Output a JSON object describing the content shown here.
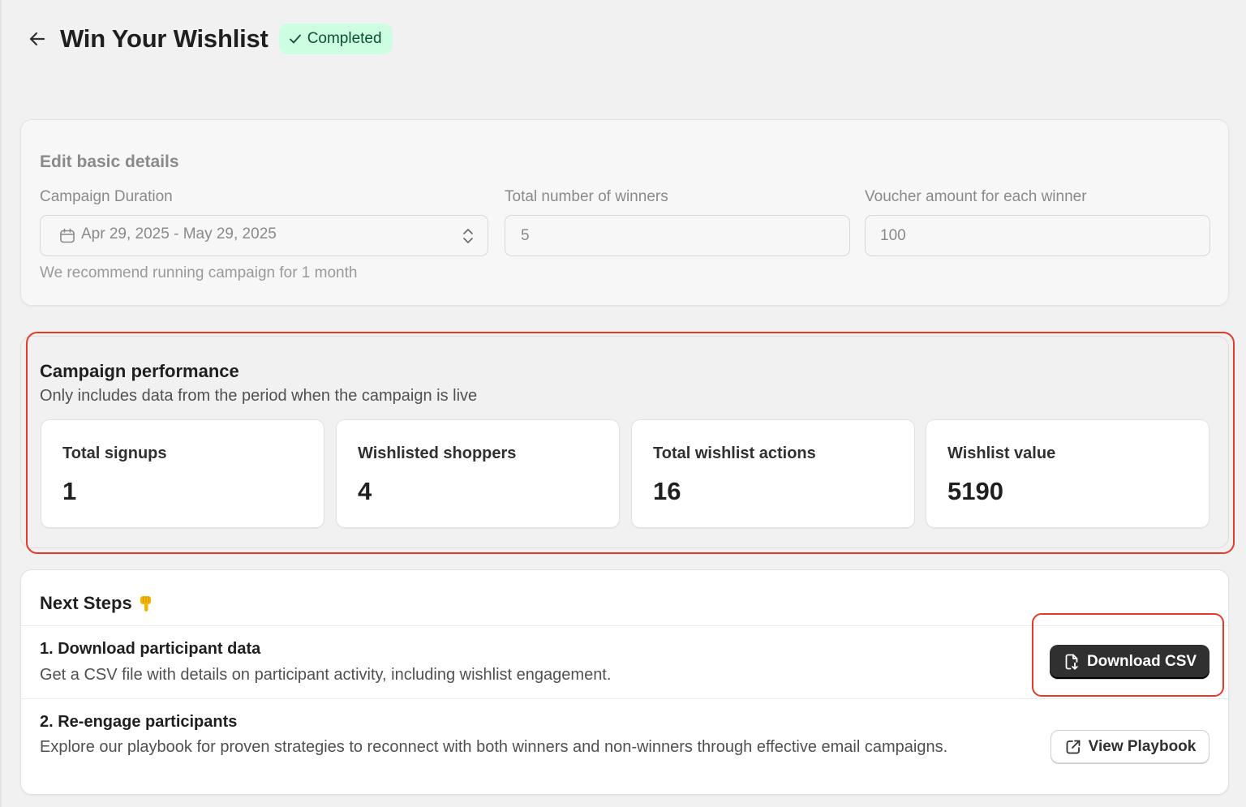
{
  "header": {
    "title": "Win Your Wishlist",
    "status_badge": "Completed"
  },
  "basic_details": {
    "title": "Edit basic details",
    "campaign_duration": {
      "label": "Campaign Duration",
      "value": "Apr 29, 2025 - May 29, 2025",
      "help": "We recommend running campaign for 1 month"
    },
    "winners": {
      "label": "Total number of winners",
      "value": "5"
    },
    "voucher": {
      "label": "Voucher amount for each winner",
      "value": "100"
    }
  },
  "performance": {
    "title": "Campaign performance",
    "subtitle": "Only includes data from the period when the campaign is live",
    "stats": [
      {
        "label": "Total signups",
        "value": "1"
      },
      {
        "label": "Wishlisted shoppers",
        "value": "4"
      },
      {
        "label": "Total wishlist actions",
        "value": "16"
      },
      {
        "label": "Wishlist value",
        "value": "5190"
      }
    ]
  },
  "next_steps": {
    "title": "Next Steps",
    "steps": [
      {
        "title": "1. Download participant data",
        "description": "Get a CSV file with details on participant activity, including wishlist engagement.",
        "button": "Download CSV"
      },
      {
        "title": "2. Re-engage participants",
        "description": "Explore our playbook for proven strategies to reconnect with both winners and non-winners through effective email campaigns.",
        "button": "View Playbook"
      }
    ]
  },
  "colors": {
    "badge_bg": "#cdfee1",
    "badge_text": "#0c5132",
    "primary_button": "#303030",
    "highlight_annotation": "#e33a2c"
  }
}
